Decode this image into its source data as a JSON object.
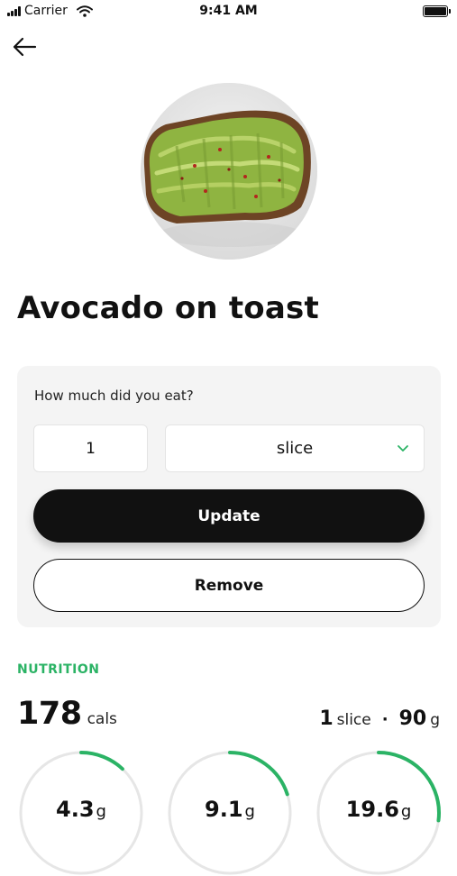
{
  "status_bar": {
    "carrier": "Carrier",
    "time": "9:41 AM"
  },
  "food": {
    "title": "Avocado on toast"
  },
  "portion": {
    "question": "How much did you eat?",
    "quantity": "1",
    "unit": "slice",
    "update_label": "Update",
    "remove_label": "Remove"
  },
  "nutrition": {
    "heading": "NUTRITION",
    "calories": "178",
    "calories_unit": "cals",
    "serving_qty": "1",
    "serving_unit": "slice",
    "serving_separator": "·",
    "serving_weight": "90",
    "serving_weight_unit": "g",
    "macros": [
      {
        "value": "4.3",
        "unit": "g",
        "fraction": 0.12
      },
      {
        "value": "9.1",
        "unit": "g",
        "fraction": 0.2
      },
      {
        "value": "19.6",
        "unit": "g",
        "fraction": 0.27
      }
    ]
  },
  "colors": {
    "accent": "#2bb365",
    "ring_track": "#e6e6e6",
    "primary": "#111111"
  },
  "icons": {
    "back": "arrow-left-icon",
    "dropdown": "chevron-down-icon"
  }
}
